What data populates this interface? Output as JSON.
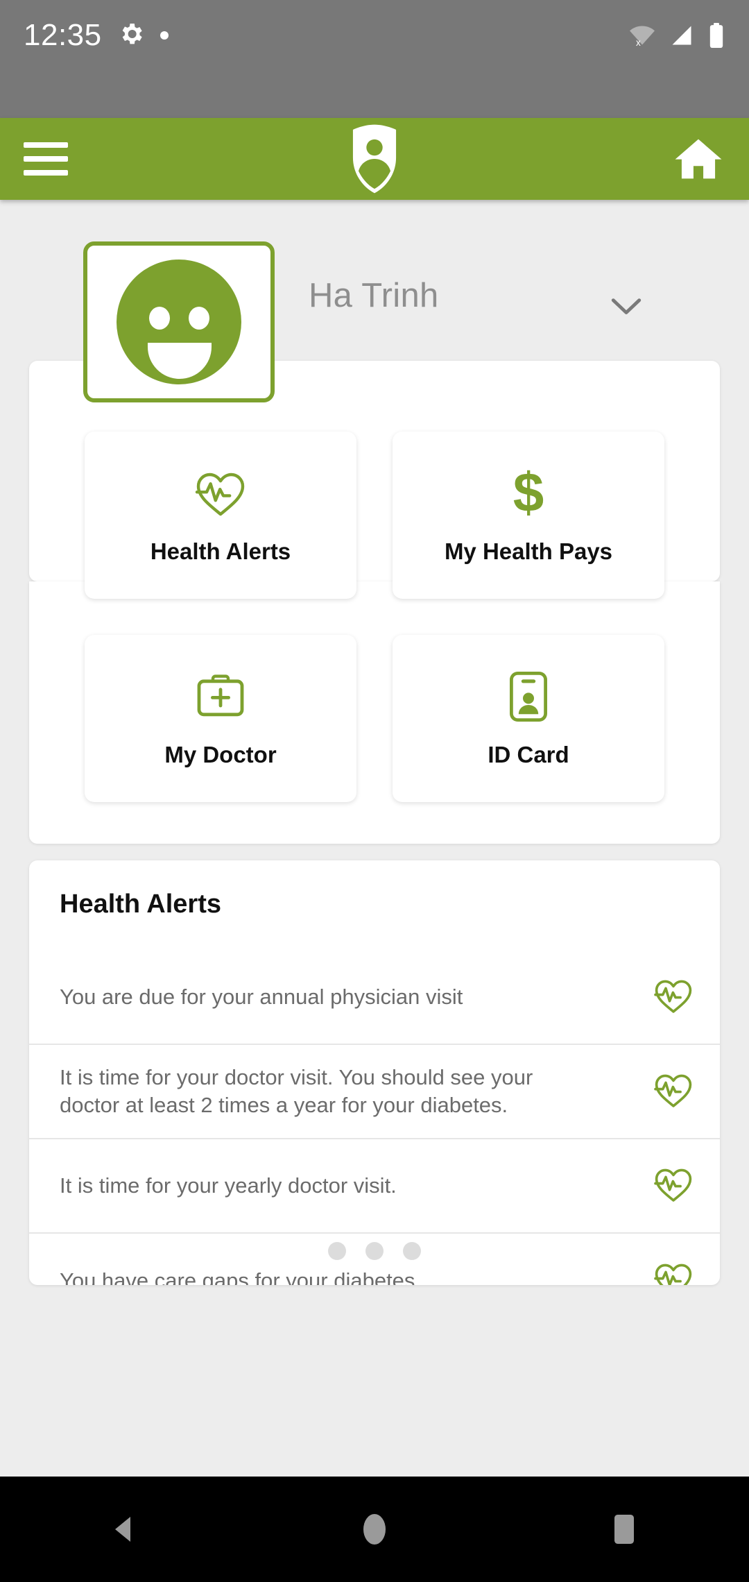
{
  "status_bar": {
    "time": "12:35",
    "icons": [
      "gear-icon",
      "notification-dot",
      "wifi-off-icon",
      "cellular-signal-icon",
      "battery-icon"
    ]
  },
  "header": {
    "menu_icon": "hamburger-menu-icon",
    "logo_icon": "shield-person-logo",
    "home_icon": "home-icon"
  },
  "profile": {
    "name": "Ha Trinh",
    "avatar_icon": "smiley-face-avatar",
    "chevron_icon": "chevron-down-icon"
  },
  "tiles": [
    {
      "label": "Health Alerts",
      "icon": "heart-pulse-icon"
    },
    {
      "label": "My Health Pays",
      "icon": "dollar-sign-icon"
    },
    {
      "label": "My Doctor",
      "icon": "first-aid-kit-icon"
    },
    {
      "label": "ID Card",
      "icon": "id-badge-icon"
    }
  ],
  "alerts_section": {
    "title": "Health Alerts",
    "items": [
      {
        "text": "You are due for your annual physician visit",
        "icon": "heart-pulse-icon"
      },
      {
        "text": "It is time for your doctor visit.  You should see your\ndoctor at least 2 times a year for your diabetes.",
        "icon": "heart-pulse-icon"
      },
      {
        "text": "It is time for your yearly doctor visit.",
        "icon": "heart-pulse-icon"
      },
      {
        "text": "You have care gaps for your diabetes",
        "icon": "heart-pulse-icon"
      }
    ],
    "pagination_dots": 3
  },
  "navbar": {
    "back_icon": "back-triangle-icon",
    "home_icon": "home-circle-icon",
    "recents_icon": "recents-square-icon"
  },
  "colors": {
    "brand_green": "#7da12e",
    "status_bar_gray": "#787878",
    "page_background": "#ededed",
    "card_white": "#ffffff",
    "body_text_gray": "#6b6b6b",
    "name_text_gray": "#8e8e8e"
  }
}
